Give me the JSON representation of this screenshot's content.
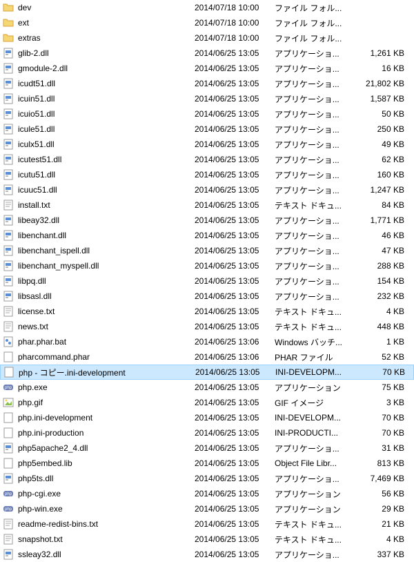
{
  "files": [
    {
      "icon": "folder",
      "name": "dev",
      "date": "2014/07/18 10:00",
      "type": "ファイル フォル...",
      "size": ""
    },
    {
      "icon": "folder",
      "name": "ext",
      "date": "2014/07/18 10:00",
      "type": "ファイル フォル...",
      "size": ""
    },
    {
      "icon": "folder",
      "name": "extras",
      "date": "2014/07/18 10:00",
      "type": "ファイル フォル...",
      "size": ""
    },
    {
      "icon": "dll",
      "name": "glib-2.dll",
      "date": "2014/06/25 13:05",
      "type": "アプリケーショ...",
      "size": "1,261 KB"
    },
    {
      "icon": "dll",
      "name": "gmodule-2.dll",
      "date": "2014/06/25 13:05",
      "type": "アプリケーショ...",
      "size": "16 KB"
    },
    {
      "icon": "dll",
      "name": "icudt51.dll",
      "date": "2014/06/25 13:05",
      "type": "アプリケーショ...",
      "size": "21,802 KB"
    },
    {
      "icon": "dll",
      "name": "icuin51.dll",
      "date": "2014/06/25 13:05",
      "type": "アプリケーショ...",
      "size": "1,587 KB"
    },
    {
      "icon": "dll",
      "name": "icuio51.dll",
      "date": "2014/06/25 13:05",
      "type": "アプリケーショ...",
      "size": "50 KB"
    },
    {
      "icon": "dll",
      "name": "icule51.dll",
      "date": "2014/06/25 13:05",
      "type": "アプリケーショ...",
      "size": "250 KB"
    },
    {
      "icon": "dll",
      "name": "iculx51.dll",
      "date": "2014/06/25 13:05",
      "type": "アプリケーショ...",
      "size": "49 KB"
    },
    {
      "icon": "dll",
      "name": "icutest51.dll",
      "date": "2014/06/25 13:05",
      "type": "アプリケーショ...",
      "size": "62 KB"
    },
    {
      "icon": "dll",
      "name": "icutu51.dll",
      "date": "2014/06/25 13:05",
      "type": "アプリケーショ...",
      "size": "160 KB"
    },
    {
      "icon": "dll",
      "name": "icuuc51.dll",
      "date": "2014/06/25 13:05",
      "type": "アプリケーショ...",
      "size": "1,247 KB"
    },
    {
      "icon": "txt",
      "name": "install.txt",
      "date": "2014/06/25 13:05",
      "type": "テキスト ドキュ...",
      "size": "84 KB"
    },
    {
      "icon": "dll",
      "name": "libeay32.dll",
      "date": "2014/06/25 13:05",
      "type": "アプリケーショ...",
      "size": "1,771 KB"
    },
    {
      "icon": "dll",
      "name": "libenchant.dll",
      "date": "2014/06/25 13:05",
      "type": "アプリケーショ...",
      "size": "46 KB"
    },
    {
      "icon": "dll",
      "name": "libenchant_ispell.dll",
      "date": "2014/06/25 13:05",
      "type": "アプリケーショ...",
      "size": "47 KB"
    },
    {
      "icon": "dll",
      "name": "libenchant_myspell.dll",
      "date": "2014/06/25 13:05",
      "type": "アプリケーショ...",
      "size": "288 KB"
    },
    {
      "icon": "dll",
      "name": "libpq.dll",
      "date": "2014/06/25 13:05",
      "type": "アプリケーショ...",
      "size": "154 KB"
    },
    {
      "icon": "dll",
      "name": "libsasl.dll",
      "date": "2014/06/25 13:05",
      "type": "アプリケーショ...",
      "size": "232 KB"
    },
    {
      "icon": "txt",
      "name": "license.txt",
      "date": "2014/06/25 13:05",
      "type": "テキスト ドキュ...",
      "size": "4 KB"
    },
    {
      "icon": "txt",
      "name": "news.txt",
      "date": "2014/06/25 13:05",
      "type": "テキスト ドキュ...",
      "size": "448 KB"
    },
    {
      "icon": "bat",
      "name": "phar.phar.bat",
      "date": "2014/06/25 13:06",
      "type": "Windows バッチ...",
      "size": "1 KB"
    },
    {
      "icon": "phar",
      "name": "pharcommand.phar",
      "date": "2014/06/25 13:06",
      "type": "PHAR ファイル",
      "size": "52 KB"
    },
    {
      "icon": "file",
      "name": "php - コピー.ini-development",
      "date": "2014/06/25 13:05",
      "type": "INI-DEVELOPM...",
      "size": "70 KB",
      "selected": true
    },
    {
      "icon": "phpexe",
      "name": "php.exe",
      "date": "2014/06/25 13:05",
      "type": "アプリケーション",
      "size": "75 KB"
    },
    {
      "icon": "gif",
      "name": "php.gif",
      "date": "2014/06/25 13:05",
      "type": "GIF イメージ",
      "size": "3 KB"
    },
    {
      "icon": "file",
      "name": "php.ini-development",
      "date": "2014/06/25 13:05",
      "type": "INI-DEVELOPM...",
      "size": "70 KB"
    },
    {
      "icon": "file",
      "name": "php.ini-production",
      "date": "2014/06/25 13:05",
      "type": "INI-PRODUCTI...",
      "size": "70 KB"
    },
    {
      "icon": "dll",
      "name": "php5apache2_4.dll",
      "date": "2014/06/25 13:05",
      "type": "アプリケーショ...",
      "size": "31 KB"
    },
    {
      "icon": "file",
      "name": "php5embed.lib",
      "date": "2014/06/25 13:05",
      "type": "Object File Libr...",
      "size": "813 KB"
    },
    {
      "icon": "dll",
      "name": "php5ts.dll",
      "date": "2014/06/25 13:05",
      "type": "アプリケーショ...",
      "size": "7,469 KB"
    },
    {
      "icon": "phpexe",
      "name": "php-cgi.exe",
      "date": "2014/06/25 13:05",
      "type": "アプリケーション",
      "size": "56 KB"
    },
    {
      "icon": "phpexe",
      "name": "php-win.exe",
      "date": "2014/06/25 13:05",
      "type": "アプリケーション",
      "size": "29 KB"
    },
    {
      "icon": "txt",
      "name": "readme-redist-bins.txt",
      "date": "2014/06/25 13:05",
      "type": "テキスト ドキュ...",
      "size": "21 KB"
    },
    {
      "icon": "txt",
      "name": "snapshot.txt",
      "date": "2014/06/25 13:05",
      "type": "テキスト ドキュ...",
      "size": "4 KB"
    },
    {
      "icon": "dll",
      "name": "ssleay32.dll",
      "date": "2014/06/25 13:05",
      "type": "アプリケーショ...",
      "size": "337 KB"
    }
  ]
}
